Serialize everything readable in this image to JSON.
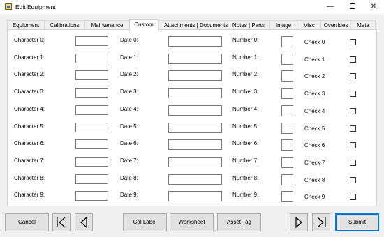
{
  "window": {
    "title": "Edit Equipment"
  },
  "tabs": [
    {
      "label": "Equipment",
      "active": false
    },
    {
      "label": "Calibrations",
      "active": false
    },
    {
      "label": "Maintenance",
      "active": false
    },
    {
      "label": "Custom",
      "active": true
    },
    {
      "label": "Attachments | Documents | Notes | Parts",
      "active": false
    },
    {
      "label": "Image",
      "active": false
    },
    {
      "label": "Misc",
      "active": false
    },
    {
      "label": "Overrides",
      "active": false
    },
    {
      "label": "Meta",
      "active": false
    }
  ],
  "fields": {
    "character": [
      "Character 0:",
      "Character 1:",
      "Character 2:",
      "Character 3:",
      "Character 4:",
      "Character 5:",
      "Character 6:",
      "Character 7:",
      "Character 8:",
      "Character 9:"
    ],
    "character_values": [
      "",
      "",
      "",
      "",
      "",
      "",
      "",
      "",
      "",
      ""
    ],
    "date": [
      "Date 0:",
      "Date 1:",
      "Date 2:",
      "Date 3:",
      "Date 4:",
      "Date 5:",
      "Date 6:",
      "Date 7:",
      "Date 8:",
      "Date 9:"
    ],
    "date_values": [
      "",
      "",
      "",
      "",
      "",
      "",
      "",
      "",
      "",
      ""
    ],
    "number": [
      "Number 0:",
      "Number 1:",
      "Number 2:",
      "Number 3:",
      "Number 4:",
      "Number 5:",
      "Number 6:",
      "Number 7:",
      "Number 8:",
      "Number 9:"
    ],
    "number_values": [
      "",
      "",
      "",
      "",
      "",
      "",
      "",
      "",
      "",
      ""
    ],
    "check": [
      "Check 0",
      "Check 1",
      "Check 2",
      "Check 3",
      "Check 4",
      "Check 5",
      "Check 6",
      "Check 7",
      "Check 8",
      "Check 9"
    ],
    "check_values": [
      false,
      false,
      false,
      false,
      false,
      false,
      false,
      false,
      false,
      false
    ]
  },
  "buttons": {
    "cancel": "Cancel",
    "cal_label": "Cal Label",
    "worksheet": "Worksheet",
    "asset_tag": "Asset Tag",
    "submit": "Submit"
  },
  "icons": {
    "first": "skip-to-first-icon",
    "previous": "previous-icon",
    "next": "next-icon",
    "last": "skip-to-last-icon"
  },
  "colors": {
    "accent": "#0078d7",
    "button_face": "#e1e1e1",
    "window_bg": "#f0f0f0"
  }
}
